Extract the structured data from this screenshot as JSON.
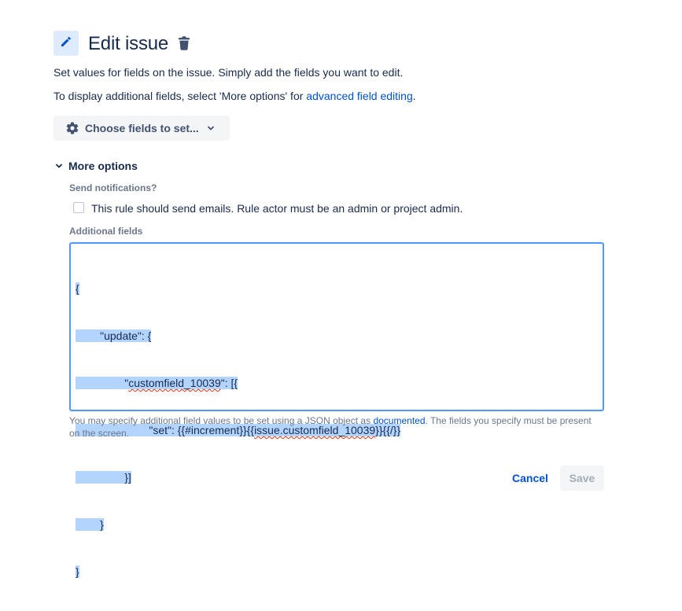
{
  "header": {
    "title": "Edit issue",
    "edit_icon": "pencil-icon",
    "delete_icon": "trash-icon"
  },
  "description": {
    "line1": "Set values for fields on the issue. Simply add the fields you want to edit.",
    "line2_prefix": "To display additional fields, select 'More options' for ",
    "line2_link": "advanced field editing",
    "line2_suffix": "."
  },
  "choose_fields": {
    "label": "Choose fields to set...",
    "icon": "gear-icon",
    "chevron": "chevron-down-icon"
  },
  "more_options": {
    "label": "More options",
    "chevron": "chevron-down-icon",
    "notifications": {
      "label": "Send notifications?",
      "checkbox_label": "This rule should send emails. Rule actor must be an admin or project admin.",
      "checked": false
    },
    "additional_fields": {
      "label": "Additional fields",
      "lines": [
        "{",
        "        \"update\": {",
        "                \"customfield_10039\": [{",
        "                        \"set\": {{#increment}}{{issue.customfield_10039}}{{/}}",
        "                }]",
        "        }",
        "}"
      ],
      "help_prefix": "You may specify additional field values to be set using a JSON object as ",
      "help_link": "documented",
      "help_suffix": ". The fields you specify must be present on the screen."
    }
  },
  "actions": {
    "cancel_label": "Cancel",
    "save_label": "Save"
  },
  "colors": {
    "link": "#0052cc",
    "selection": "#b3d4ff",
    "focus_border": "#4c9aff"
  }
}
